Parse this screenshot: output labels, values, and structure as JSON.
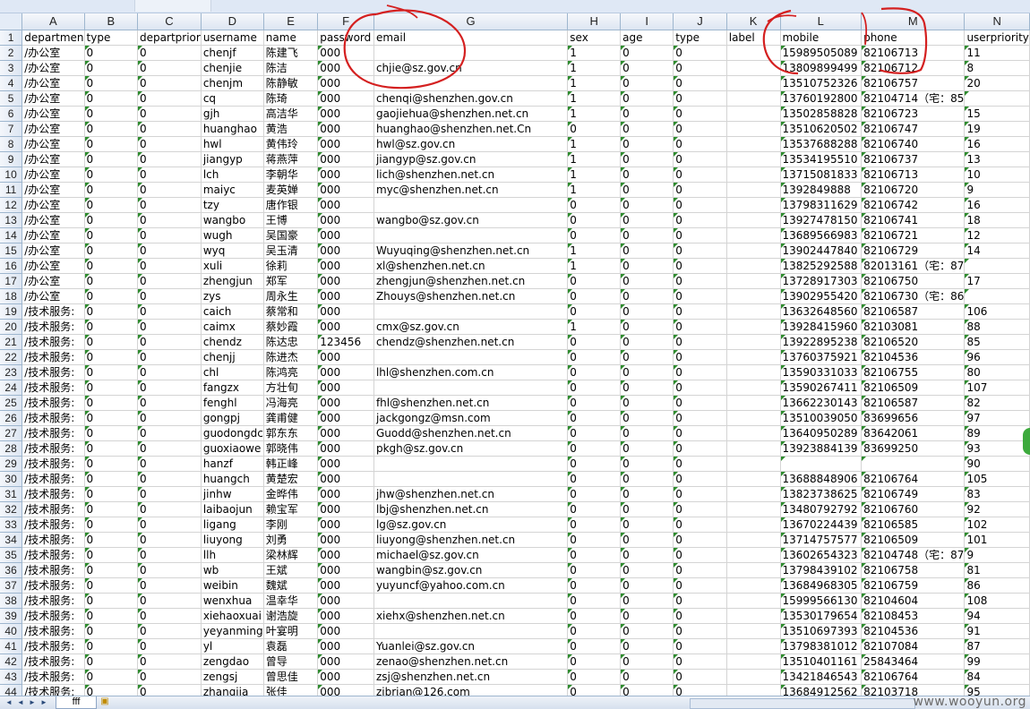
{
  "columns": [
    "A",
    "B",
    "C",
    "D",
    "E",
    "F",
    "G",
    "H",
    "I",
    "J",
    "K",
    "L",
    "M",
    "N"
  ],
  "header_row": [
    "departmen",
    "type",
    "departprior",
    "username",
    "name",
    "password",
    "email",
    "sex",
    "age",
    "type",
    "label",
    "mobile",
    "phone",
    "userpriority"
  ],
  "rows": [
    [
      "/办公室",
      "0",
      "0",
      "chenjf",
      "陈建飞",
      "000",
      "",
      "1",
      "0",
      "0",
      "",
      "15989505089",
      "82106713",
      "11"
    ],
    [
      "/办公室",
      "0",
      "0",
      "chenjie",
      "陈洁",
      "000",
      "chjie@sz.gov.cn",
      "1",
      "0",
      "0",
      "",
      "13809899499",
      "82106712",
      "8"
    ],
    [
      "/办公室",
      "0",
      "0",
      "chenjm",
      "陈静敏",
      "000",
      "",
      "1",
      "0",
      "0",
      "",
      "13510752326",
      "82106757",
      "20"
    ],
    [
      "/办公室",
      "0",
      "0",
      "cq",
      "陈琦",
      "000",
      "chenqi@shenzhen.gov.cn",
      "1",
      "0",
      "0",
      "",
      "13760192800",
      "82104714（宅：85",
      ""
    ],
    [
      "/办公室",
      "0",
      "0",
      "gjh",
      "高洁华",
      "000",
      "gaojiehua@shenzhen.net.cn",
      "1",
      "0",
      "0",
      "",
      "13502858828",
      "82106723",
      "15"
    ],
    [
      "/办公室",
      "0",
      "0",
      "huanghao",
      "黄浩",
      "000",
      "huanghao@shenzhen.net.Cn",
      "0",
      "0",
      "0",
      "",
      "13510620502",
      "82106747",
      "19"
    ],
    [
      "/办公室",
      "0",
      "0",
      "hwl",
      "黄伟玲",
      "000",
      "hwl@sz.gov.cn",
      "1",
      "0",
      "0",
      "",
      "13537688288",
      "82106740",
      "16"
    ],
    [
      "/办公室",
      "0",
      "0",
      "jiangyp",
      "蒋燕萍",
      "000",
      "jiangyp@sz.gov.cn",
      "1",
      "0",
      "0",
      "",
      "13534195510",
      "82106737",
      "13"
    ],
    [
      "/办公室",
      "0",
      "0",
      "lch",
      "李朝华",
      "000",
      "lich@shenzhen.net.cn",
      "1",
      "0",
      "0",
      "",
      "13715081833",
      "82106713",
      "10"
    ],
    [
      "/办公室",
      "0",
      "0",
      "maiyc",
      "麦英婵",
      "000",
      "myc@shenzhen.net.cn",
      "1",
      "0",
      "0",
      "",
      "1392849888",
      "82106720",
      "9"
    ],
    [
      "/办公室",
      "0",
      "0",
      "tzy",
      "唐作银",
      "000",
      "",
      "0",
      "0",
      "0",
      "",
      "13798311629",
      "82106742",
      "16"
    ],
    [
      "/办公室",
      "0",
      "0",
      "wangbo",
      "王博",
      "000",
      "wangbo@sz.gov.cn",
      "0",
      "0",
      "0",
      "",
      "13927478150",
      "82106741",
      "18"
    ],
    [
      "/办公室",
      "0",
      "0",
      "wugh",
      "吴国豪",
      "000",
      "",
      "0",
      "0",
      "0",
      "",
      "13689566983",
      "82106721",
      "12"
    ],
    [
      "/办公室",
      "0",
      "0",
      "wyq",
      "吴玉清",
      "000",
      "Wuyuqing@shenzhen.net.cn",
      "1",
      "0",
      "0",
      "",
      "13902447840",
      "82106729",
      "14"
    ],
    [
      "/办公室",
      "0",
      "0",
      "xuli",
      "徐莉",
      "000",
      "xl@shenzhen.net.cn",
      "1",
      "0",
      "0",
      "",
      "13825292588",
      "82013161（宅：87",
      ""
    ],
    [
      "/办公室",
      "0",
      "0",
      "zhengjun",
      "郑军",
      "000",
      "zhengjun@shenzhen.net.cn",
      "0",
      "0",
      "0",
      "",
      "13728917303",
      "82106750",
      "17"
    ],
    [
      "/办公室",
      "0",
      "0",
      "zys",
      "周永生",
      "000",
      "Zhouys@shenzhen.net.cn",
      "0",
      "0",
      "0",
      "",
      "13902955420",
      "82106730（宅：86",
      ""
    ],
    [
      "/技术服务:",
      "0",
      "0",
      "caich",
      "蔡常和",
      "000",
      "",
      "0",
      "0",
      "0",
      "",
      "13632648560",
      "82106587",
      "106"
    ],
    [
      "/技术服务:",
      "0",
      "0",
      "caimx",
      "蔡妙霞",
      "000",
      "cmx@sz.gov.cn",
      "1",
      "0",
      "0",
      "",
      "13928415960",
      "82103081",
      "88"
    ],
    [
      "/技术服务:",
      "0",
      "0",
      "chendz",
      "陈达忠",
      "123456",
      "chendz@shenzhen.net.cn",
      "0",
      "0",
      "0",
      "",
      "13922895238",
      "82106520",
      "85"
    ],
    [
      "/技术服务:",
      "0",
      "0",
      "chenjj",
      "陈进杰",
      "000",
      "",
      "0",
      "0",
      "0",
      "",
      "13760375921",
      "82104536",
      "96"
    ],
    [
      "/技术服务:",
      "0",
      "0",
      "chl",
      "陈鸿亮",
      "000",
      "lhl@shenzhen.com.cn",
      "0",
      "0",
      "0",
      "",
      "13590331033",
      "82106755",
      "80"
    ],
    [
      "/技术服务:",
      "0",
      "0",
      "fangzx",
      "方壮旬",
      "000",
      "",
      "0",
      "0",
      "0",
      "",
      "13590267411",
      "82106509",
      "107"
    ],
    [
      "/技术服务:",
      "0",
      "0",
      "fenghl",
      "冯海亮",
      "000",
      "fhl@shenzhen.net.cn",
      "0",
      "0",
      "0",
      "",
      "13662230143",
      "82106587",
      "82"
    ],
    [
      "/技术服务:",
      "0",
      "0",
      "gongpj",
      "龚甫健",
      "000",
      "jackgongz@msn.com",
      "0",
      "0",
      "0",
      "",
      "13510039050",
      "83699656",
      "97"
    ],
    [
      "/技术服务:",
      "0",
      "0",
      "guodongdc",
      "郭东东",
      "000",
      "Guodd@shenzhen.net.cn",
      "0",
      "0",
      "0",
      "",
      "13640950289",
      "83642061",
      "89"
    ],
    [
      "/技术服务:",
      "0",
      "0",
      "guoxiaowe",
      "郭晓伟",
      "000",
      "pkgh@sz.gov.cn",
      "0",
      "0",
      "0",
      "",
      "13923884139",
      "83699250",
      "93"
    ],
    [
      "/技术服务:",
      "0",
      "0",
      "hanzf",
      "韩正峰",
      "000",
      "",
      "0",
      "0",
      "0",
      "",
      "",
      "",
      "90"
    ],
    [
      "/技术服务:",
      "0",
      "0",
      "huangch",
      "黄楚宏",
      "000",
      "",
      "0",
      "0",
      "0",
      "",
      "13688848906",
      "82106764",
      "105"
    ],
    [
      "/技术服务:",
      "0",
      "0",
      "jinhw",
      "金晔伟",
      "000",
      "jhw@shenzhen.net.cn",
      "0",
      "0",
      "0",
      "",
      "13823738625",
      "82106749",
      "83"
    ],
    [
      "/技术服务:",
      "0",
      "0",
      "laibaojun",
      "赖宝军",
      "000",
      "lbj@shenzhen.net.cn",
      "0",
      "0",
      "0",
      "",
      "13480792792",
      "82106760",
      "92"
    ],
    [
      "/技术服务:",
      "0",
      "0",
      "ligang",
      "李刚",
      "000",
      "lg@sz.gov.cn",
      "0",
      "0",
      "0",
      "",
      "13670224439",
      "82106585",
      "102"
    ],
    [
      "/技术服务:",
      "0",
      "0",
      "liuyong",
      "刘勇",
      "000",
      "liuyong@shenzhen.net.cn",
      "0",
      "0",
      "0",
      "",
      "13714757577",
      "82106509",
      "101"
    ],
    [
      "/技术服务:",
      "0",
      "0",
      "llh",
      "梁林辉",
      "000",
      "michael@sz.gov.cn",
      "0",
      "0",
      "0",
      "",
      "13602654323",
      "82104748（宅：87",
      "9"
    ],
    [
      "/技术服务:",
      "0",
      "0",
      "wb",
      "王斌",
      "000",
      "wangbin@sz.gov.cn",
      "0",
      "0",
      "0",
      "",
      "13798439102",
      "82106758",
      "81"
    ],
    [
      "/技术服务:",
      "0",
      "0",
      "weibin",
      "魏斌",
      "000",
      "yuyuncf@yahoo.com.cn",
      "0",
      "0",
      "0",
      "",
      "13684968305",
      "82106759",
      "86"
    ],
    [
      "/技术服务:",
      "0",
      "0",
      "wenxhua",
      "温幸华",
      "000",
      "",
      "0",
      "0",
      "0",
      "",
      "15999566130",
      "82104604",
      "108"
    ],
    [
      "/技术服务:",
      "0",
      "0",
      "xiehaoxuai",
      "谢浩旋",
      "000",
      "xiehx@shenzhen.net.cn",
      "0",
      "0",
      "0",
      "",
      "13530179654",
      "82108453",
      "94"
    ],
    [
      "/技术服务:",
      "0",
      "0",
      "yeyanming",
      "叶宴明",
      "000",
      "",
      "0",
      "0",
      "0",
      "",
      "13510697393",
      "82104536",
      "91"
    ],
    [
      "/技术服务:",
      "0",
      "0",
      "yl",
      "袁磊",
      "000",
      "Yuanlei@sz.gov.cn",
      "0",
      "0",
      "0",
      "",
      "13798381012",
      "82107084",
      "87"
    ],
    [
      "/技术服务:",
      "0",
      "0",
      "zengdao",
      "曾导",
      "000",
      "zenao@shenzhen.net.cn",
      "0",
      "0",
      "0",
      "",
      "13510401161",
      "25843464",
      "99"
    ],
    [
      "/技术服务:",
      "0",
      "0",
      "zengsj",
      "曾思佳",
      "000",
      "zsj@shenzhen.net.cn",
      "0",
      "0",
      "0",
      "",
      "13421846543",
      "82106764",
      "84"
    ],
    [
      "/技术服务:",
      "0",
      "0",
      "zhangjia",
      "张佳",
      "000",
      "zibrian@126.com",
      "0",
      "0",
      "0",
      "",
      "13684912562",
      "82103718",
      "95"
    ]
  ],
  "sheet_tab": "fff",
  "watermark": "www.wooyun.org",
  "colors": {
    "header_bg": "#dde6f2",
    "grid": "#d4d4d4",
    "annotation": "#d42020",
    "number_flag": "#2e8b2e"
  }
}
